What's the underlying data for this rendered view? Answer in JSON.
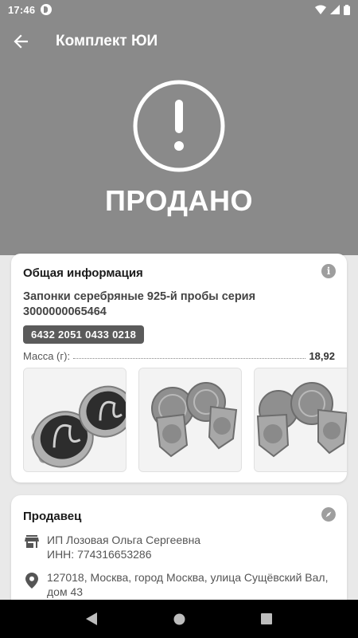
{
  "status_bar": {
    "time": "17:46"
  },
  "header": {
    "title": "Комплект ЮИ",
    "status_text": "ПРОДАНО",
    "background": "#8a8a8a"
  },
  "general": {
    "section_title": "Общая информация",
    "product_name": "Запонки серебряные 925-й пробы серия 3000000065464",
    "barcode": "6432 2051 0433 0218",
    "mass_label": "Масса (г):",
    "mass_value": "18,92",
    "photos": [
      "cufflinks-photo-1",
      "cufflinks-photo-2",
      "cufflinks-photo-3"
    ]
  },
  "seller": {
    "section_title": "Продавец",
    "name": "ИП Лозовая Ольга Сергеевна",
    "inn": "ИНН: 774316653286",
    "address": "127018, Москва, город Москва, улица Сущёвский Вал, дом 43"
  },
  "icons": [
    "back-arrow-icon",
    "exclamation-circle-icon",
    "info-icon",
    "compass-icon",
    "store-icon",
    "location-pin-icon"
  ]
}
